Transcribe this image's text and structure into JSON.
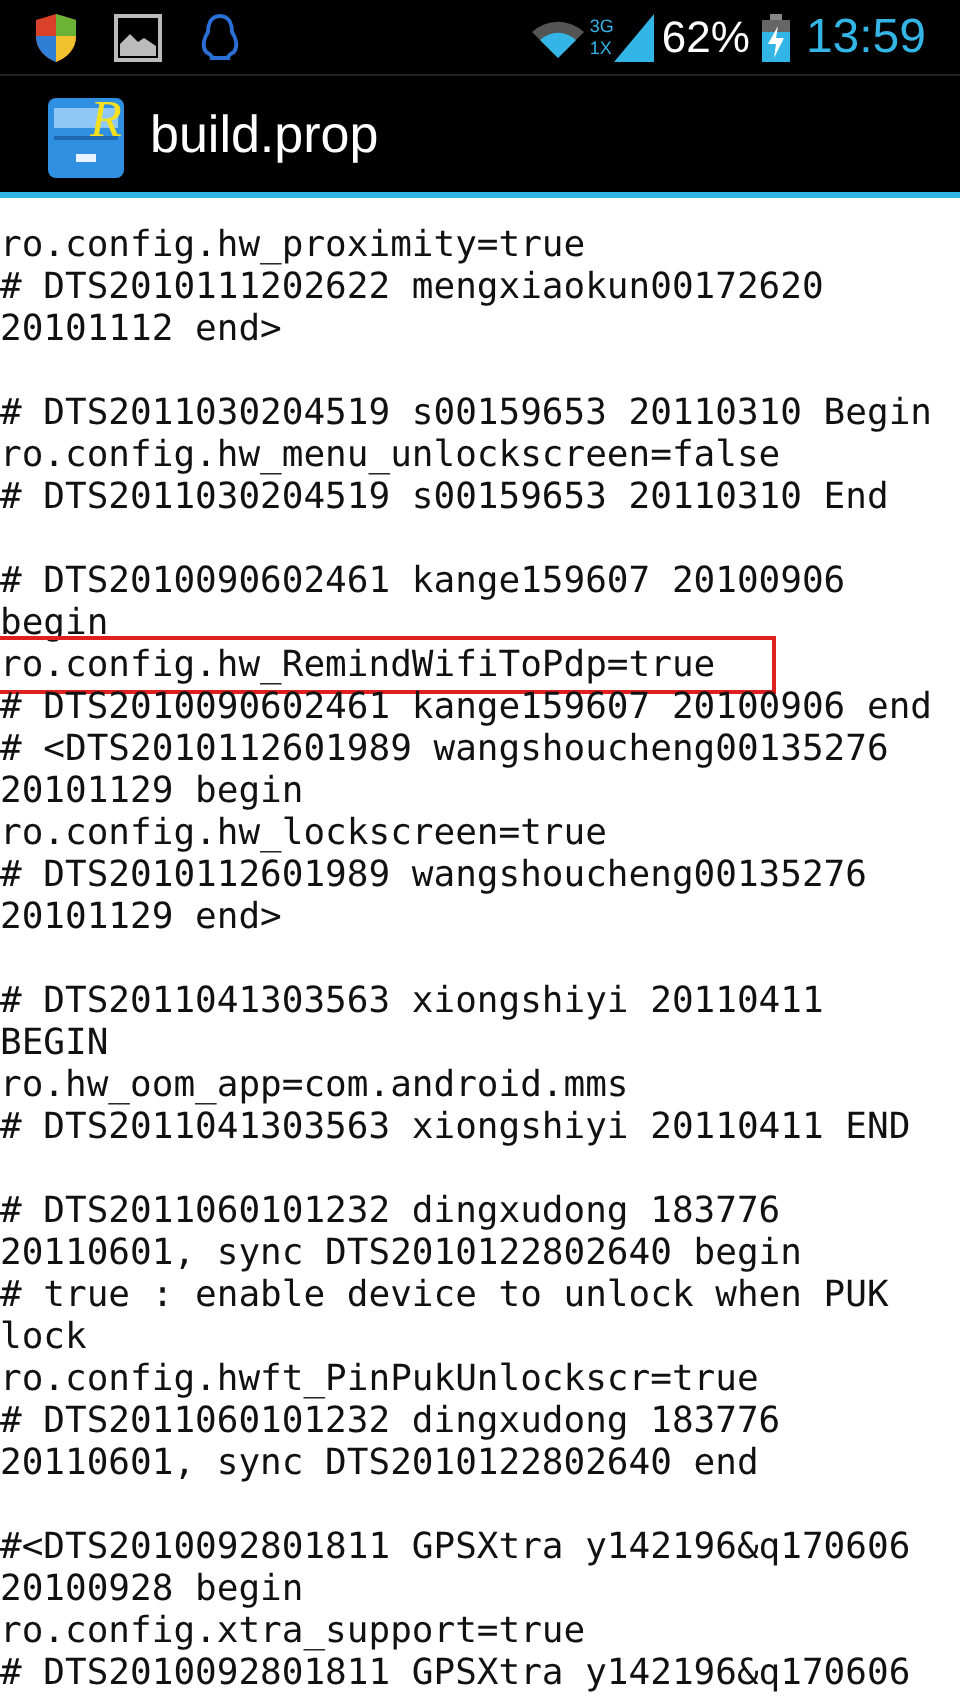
{
  "status_bar": {
    "network_3g": "3G",
    "network_1x": "1X",
    "battery": "62%",
    "time": "13:59"
  },
  "action_bar": {
    "app_icon_letter": "R",
    "title": "build.prop"
  },
  "blocks": [
    {
      "lines": [
        {
          "text": "ro.config.hw_proximity=true",
          "highlighted": false
        },
        {
          "text": "# DTS2010111202622 mengxiaokun00172620",
          "highlighted": false
        },
        {
          "text": "20101112 end>",
          "highlighted": false
        }
      ]
    },
    {
      "lines": [
        {
          "text": "# DTS2011030204519 s00159653 20110310 Begin",
          "highlighted": false
        },
        {
          "text": "ro.config.hw_menu_unlockscreen=false",
          "highlighted": false
        },
        {
          "text": "# DTS2011030204519 s00159653 20110310 End",
          "highlighted": false
        }
      ]
    },
    {
      "lines": [
        {
          "text": "# DTS2010090602461 kange159607 20100906",
          "highlighted": false
        },
        {
          "text": "begin",
          "highlighted": false
        },
        {
          "text": "ro.config.hw_RemindWifiToPdp=true",
          "highlighted": true
        },
        {
          "text": "# DTS2010090602461 kange159607 20100906 end",
          "highlighted": false
        },
        {
          "text": "# <DTS2010112601989 wangshoucheng00135276",
          "highlighted": false
        },
        {
          "text": "20101129 begin",
          "highlighted": false
        },
        {
          "text": "ro.config.hw_lockscreen=true",
          "highlighted": false
        },
        {
          "text": "# DTS2010112601989 wangshoucheng00135276",
          "highlighted": false
        },
        {
          "text": "20101129 end>",
          "highlighted": false
        }
      ]
    },
    {
      "lines": [
        {
          "text": "# DTS2011041303563 xiongshiyi 20110411",
          "highlighted": false
        },
        {
          "text": "BEGIN",
          "highlighted": false
        },
        {
          "text": "ro.hw_oom_app=com.android.mms",
          "highlighted": false
        },
        {
          "text": "# DTS2011041303563 xiongshiyi 20110411 END",
          "highlighted": false
        }
      ]
    },
    {
      "lines": [
        {
          "text": "# DTS2011060101232 dingxudong 183776",
          "highlighted": false
        },
        {
          "text": "20110601, sync DTS2010122802640 begin",
          "highlighted": false
        },
        {
          "text": "# true : enable device to unlock when PUK",
          "highlighted": false
        },
        {
          "text": "lock",
          "highlighted": false
        },
        {
          "text": "ro.config.hwft_PinPukUnlockscr=true",
          "highlighted": false
        },
        {
          "text": "# DTS2011060101232 dingxudong 183776",
          "highlighted": false
        },
        {
          "text": "20110601, sync DTS2010122802640 end",
          "highlighted": false
        }
      ]
    },
    {
      "lines": [
        {
          "text": "#<DTS2010092801811 GPSXtra y142196&q170606",
          "highlighted": false
        },
        {
          "text": "20100928 begin",
          "highlighted": false
        },
        {
          "text": "ro.config.xtra_support=true",
          "highlighted": false
        },
        {
          "text": "# DTS2010092801811 GPSXtra y142196&q170606",
          "highlighted": false
        }
      ]
    }
  ]
}
